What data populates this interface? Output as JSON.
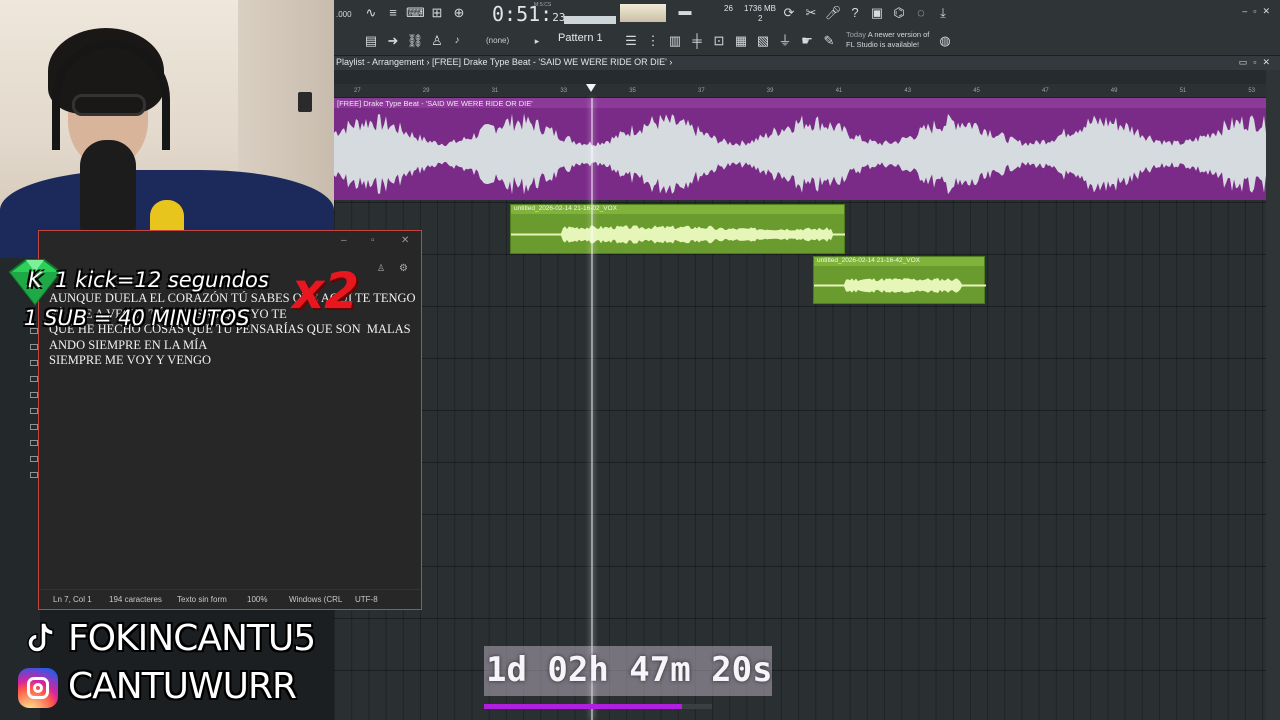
{
  "toolbar": {
    "clock": "0:51",
    "clock_frames": "23",
    "clock_label": "M:S:CS",
    "memory": "1736 MB",
    "memory_sub": "2",
    "polyphony": "26",
    "pattern": "Pattern 1",
    "none_label": "(none)",
    "news_time": "Today",
    "news_line1": "A newer version of",
    "news_line2": "FL Studio is available!",
    "tempo_frag": ".000"
  },
  "playlist": {
    "breadcrumb": "Playlist - Arrangement  ›  [FREE] Drake Type Beat - 'SAID WE WERE RIDE OR DIE'  ›",
    "bars": [
      "27",
      "29",
      "31",
      "33",
      "35",
      "37",
      "39",
      "41",
      "43",
      "45",
      "47",
      "49",
      "51",
      "53"
    ],
    "beat_clip_title": "[FREE] Drake Type Beat - 'SAID WE WERE RIDE OR DIE'",
    "vox_clips": [
      {
        "title": "untitled_2026-02-14 21-16-02_VOX"
      },
      {
        "title": "untitled_2026-02-14 21-16-42_VOX"
      }
    ],
    "colors": {
      "beat": "#7a2a87",
      "vox": "#6a9b2f"
    }
  },
  "notepad": {
    "lines": [
      "AUNQUE DUELA EL CORAZÓN TÚ SABES QUE AQUÍ TE TENGO",
      "SÉ QUE A VECES TÚ PIENSAS QUE YO TE",
      "QUE HE HECHO COSAS QUE TÚ PENSARÍAS QUE SON  MALAS",
      "ANDO SIEMPRE EN LA MÍA",
      "SIEMPRE ME VOY Y VENGO"
    ],
    "status": {
      "position": "Ln 7, Col 1",
      "chars": "194 caracteres",
      "format": "Texto sin form",
      "zoom": "100%",
      "eol": "Windows (CRL",
      "encoding": "UTF-8"
    }
  },
  "overlay": {
    "kick_text": "K  1 kick=12 segundos",
    "sub_text": "1 SUB = 40 MINUTOS",
    "multiplier": "x2",
    "tiktok": "FOKINCANTU5",
    "instagram": "CANTUWURR",
    "timer": "1d 02h 47m 20s",
    "timer_progress": 0.87
  },
  "icons": [
    "play-icon",
    "stop-icon",
    "record-icon",
    "metronome-icon",
    "settings-icon",
    "minimize-icon",
    "maximize-icon",
    "close-icon",
    "tiktok-icon",
    "instagram-icon",
    "gem-icon"
  ]
}
